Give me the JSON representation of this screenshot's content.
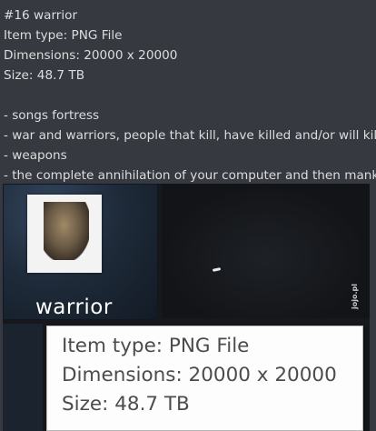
{
  "message": {
    "lines": [
      "#16 warrior",
      "Item type: PNG File",
      "Dimensions: 20000 x 20000",
      "Size: 48.7 TB",
      "",
      "- songs fortress",
      "- war and warriors, people that kill, have killed and/or will kill a",
      "- weapons",
      "- the complete annihilation of your computer and then mankin"
    ]
  },
  "thumbnail": {
    "label": "warrior"
  },
  "watermark": "jojo.pl",
  "tooltip": {
    "item_type": "Item type: PNG File",
    "dimensions": "Dimensions: 20000 x 20000",
    "size": "Size: 48.7 TB"
  }
}
